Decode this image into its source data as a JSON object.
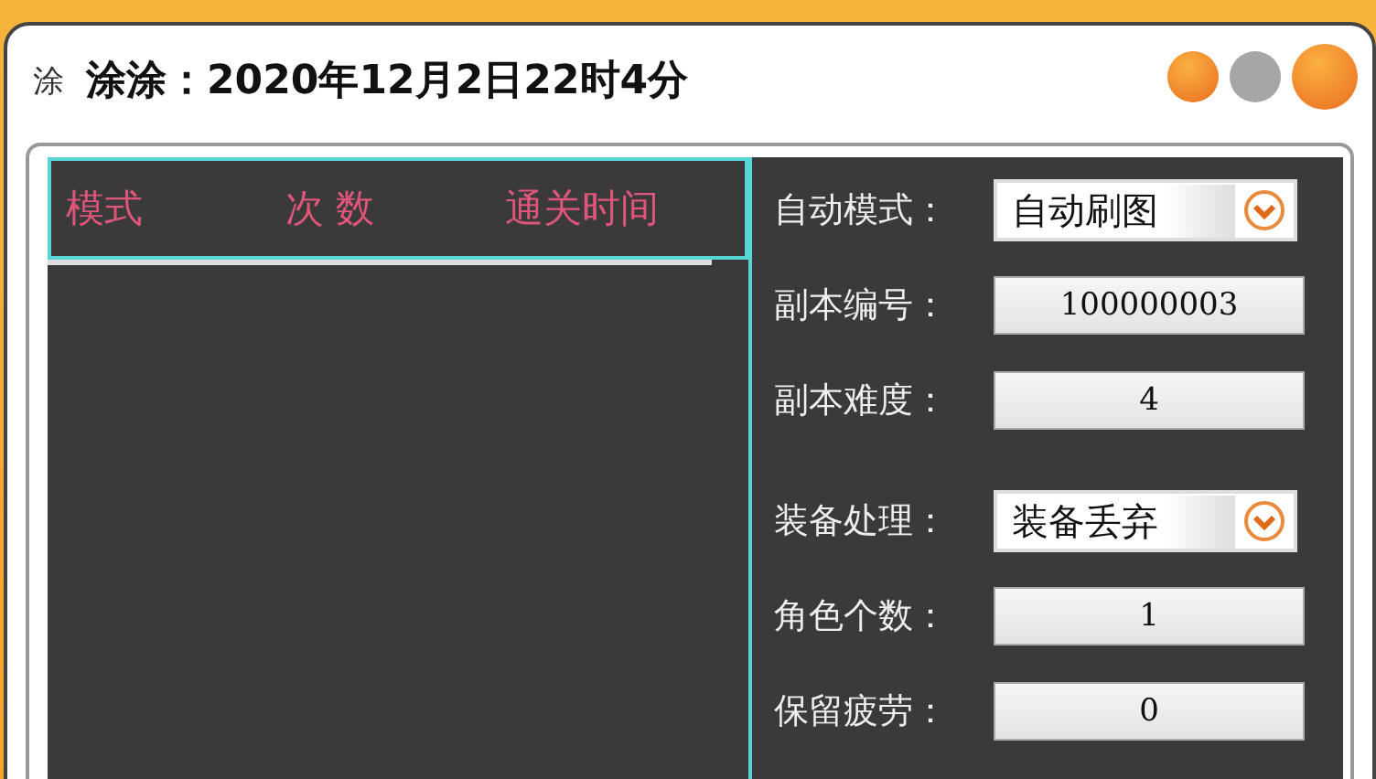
{
  "window": {
    "icon_char": "涂",
    "title": "涂涂：2020年12月2日22时4分"
  },
  "table": {
    "columns": [
      "模式",
      "次 数",
      "通关时间"
    ]
  },
  "settings": [
    {
      "label": "自动模式：",
      "kind": "select",
      "value": "自动刷图"
    },
    {
      "label": "副本编号：",
      "kind": "input",
      "value": "100000003"
    },
    {
      "label": "副本难度：",
      "kind": "input",
      "value": "4"
    },
    {
      "label": "装备处理：",
      "kind": "select",
      "value": "装备丢弃"
    },
    {
      "label": "角色个数：",
      "kind": "input",
      "value": "1"
    },
    {
      "label": "保留疲劳：",
      "kind": "input",
      "value": "0"
    }
  ]
}
